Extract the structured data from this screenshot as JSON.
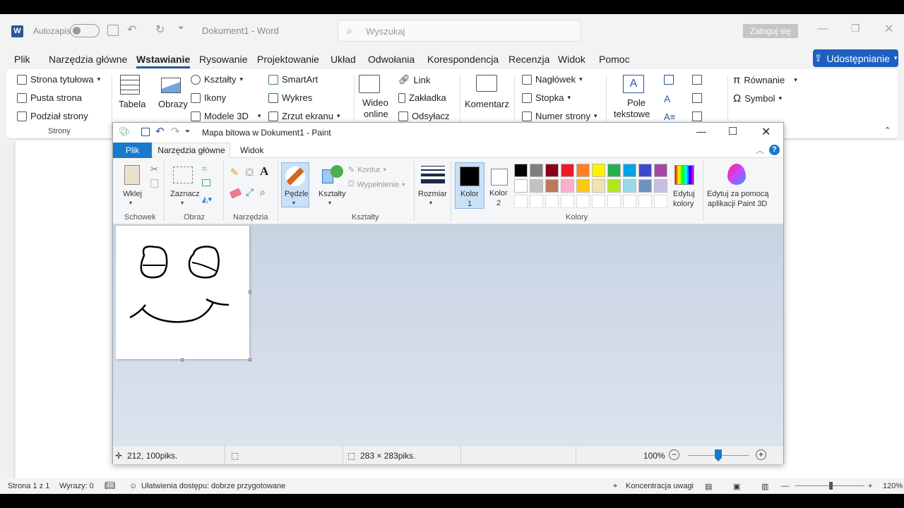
{
  "word": {
    "autosave_label": "Autozapis",
    "doc_title": "Dokument1 - Word",
    "search_placeholder": "Wyszukaj",
    "signin_label": "Zaloguj się",
    "share_label": "Udostępnianie",
    "tabs": [
      "Plik",
      "Narzędzia główne",
      "Wstawianie",
      "Rysowanie",
      "Projektowanie",
      "Układ",
      "Odwołania",
      "Korespondencja",
      "Recenzja",
      "Widok",
      "Pomoc"
    ],
    "active_tab": "Wstawianie",
    "ribbon": {
      "cover_page": "Strona tytułowa",
      "blank_page": "Pusta strona",
      "page_break": "Podział strony",
      "pages_group": "Strony",
      "table": "Tabela",
      "pictures": "Obrazy",
      "shapes": "Kształty",
      "icons": "Ikony",
      "models3d": "Modele 3D",
      "smartart": "SmartArt",
      "chart": "Wykres",
      "screenshot": "Zrzut ekranu",
      "video_line1": "Wideo",
      "video_line2": "online",
      "link": "Link",
      "bookmark": "Zakładka",
      "crossref": "Odsyłacz",
      "comment": "Komentarz",
      "header": "Nagłówek",
      "footer": "Stopka",
      "page_number": "Numer strony",
      "textbox_line1": "Pole",
      "textbox_line2": "tekstowe",
      "equation": "Równanie",
      "symbol": "Symbol"
    },
    "status": {
      "page": "Strona 1 z 1",
      "words": "Wyrazy: 0",
      "accessibility": "Ułatwienia dostępu: dobrze przygotowane",
      "focus": "Koncentracja uwagi",
      "zoom": "120%"
    }
  },
  "paint": {
    "title": "Mapa bitowa w Dokument1 - Paint",
    "tabs": [
      "Plik",
      "Narzędzia główne",
      "Widok"
    ],
    "active_tab": "Narzędzia główne",
    "clipboard": "Wklej",
    "clipboard_group": "Schowek",
    "select": "Zaznacz",
    "image_group": "Obraz",
    "tools_group": "Narzędzia",
    "brushes": "Pędzle",
    "shapes": "Kształty",
    "outline": "Kontur",
    "fill": "Wypełnienie",
    "shapes_group": "Kształty",
    "size": "Rozmiar",
    "color1_line1": "Kolor",
    "color1_line2": "1",
    "color2_line1": "Kolor",
    "color2_line2": "2",
    "edit_colors_line1": "Edytuj",
    "edit_colors_line2": "kolory",
    "paint3d_line1": "Edytuj za pomocą",
    "paint3d_line2": "aplikacji Paint 3D",
    "colors_group": "Kolory",
    "palette_row1": [
      "#000000",
      "#7f7f7f",
      "#880015",
      "#ed1c24",
      "#ff7f27",
      "#fff200",
      "#22b14c",
      "#00a2e8",
      "#3f48cc",
      "#a349a4"
    ],
    "palette_row2": [
      "#ffffff",
      "#c3c3c3",
      "#b97a57",
      "#ffaec9",
      "#ffc90e",
      "#efe4b0",
      "#b5e61d",
      "#99d9ea",
      "#7092be",
      "#c8bfe7"
    ],
    "cursor_pos": "212, 100piks.",
    "image_size": "283 × 283piks.",
    "zoom": "100%"
  }
}
